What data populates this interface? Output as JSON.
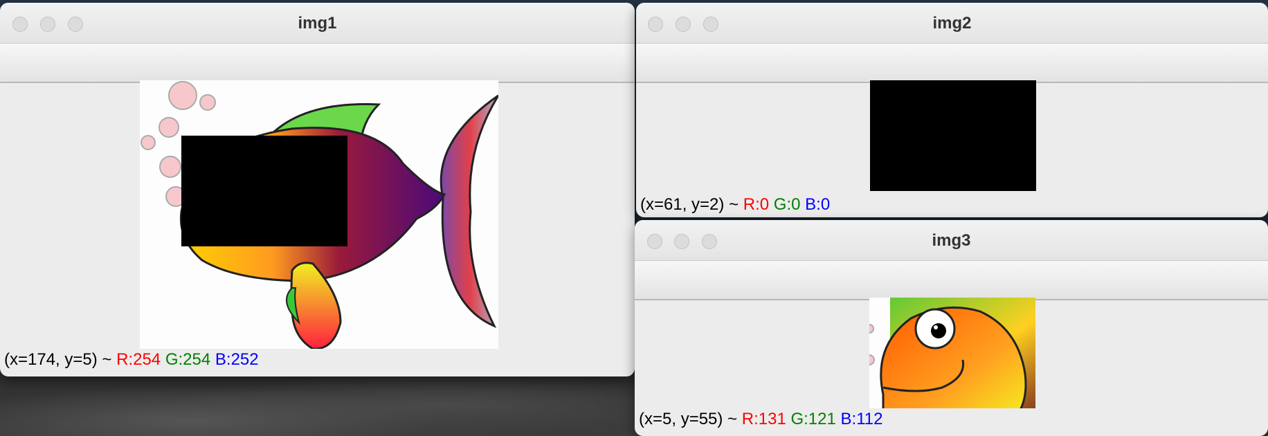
{
  "windows": {
    "img1": {
      "title": "img1",
      "status": {
        "coords": "(x=174, y=5) ~",
        "r": "R:254",
        "g": "G:254",
        "b": "B:252"
      }
    },
    "img2": {
      "title": "img2",
      "status": {
        "coords": "(x=61, y=2) ~",
        "r": "R:0",
        "g": "G:0",
        "b": "B:0"
      }
    },
    "img3": {
      "title": "img3",
      "status": {
        "coords": "(x=5, y=55) ~",
        "r": "R:131",
        "g": "G:121",
        "b": "B:112"
      }
    }
  },
  "colors": {
    "r_label": "#ff0000",
    "g_label": "#008000",
    "b_label": "#0000ff",
    "window_bg": "#ececec"
  },
  "icons": [
    "close-button",
    "minimize-button",
    "zoom-button"
  ]
}
